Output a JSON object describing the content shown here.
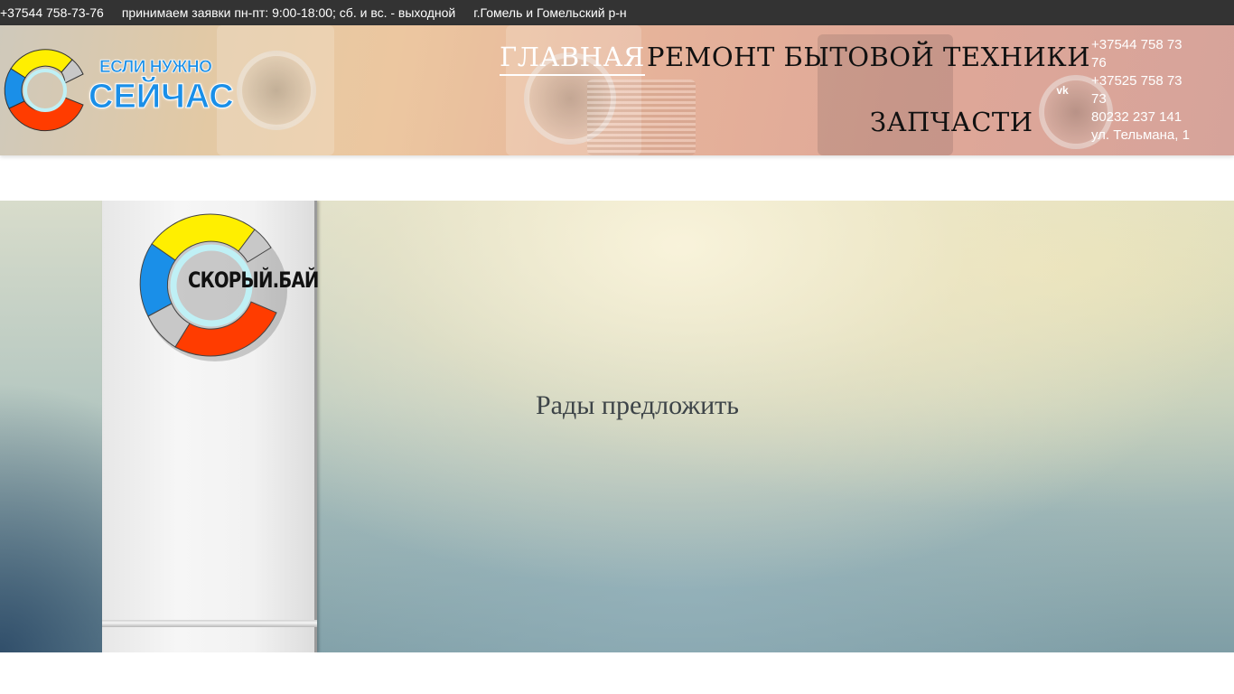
{
  "topbar": {
    "phone": "+37544 758-73-76",
    "hours": "принимаем заявки пн-пт: 9:00-18:00; сб. и вс. - выходной",
    "region": "г.Гомель и Гомельский р-н"
  },
  "logo": {
    "small_text": "ЕСЛИ НУЖНО",
    "big_text": "СЕЙЧАС"
  },
  "nav": {
    "home": "ГЛАВНАЯ",
    "repair": "РЕМОНТ БЫТОВОЙ ТЕХНИКИ",
    "parts": "ЗАПЧАСТИ"
  },
  "social": {
    "vk_label": "vk",
    "icon": "vk-icon"
  },
  "contacts": {
    "phone1_a": "+37544 758 73",
    "phone1_b": "76",
    "phone2_a": "+37525 758 73",
    "phone2_b": "73",
    "phone3": "80232 237 141",
    "address": "ул. Тельмана, 1"
  },
  "hero": {
    "brand_text": "СКОРЫЙ.БАЙ",
    "tagline": "Рады предложить"
  },
  "colors": {
    "topbar_bg": "#333333",
    "logo_blue": "#1a8fe8",
    "logo_red": "#ff3c00",
    "logo_yellow": "#ffef00",
    "logo_gray": "#c8c8c8"
  }
}
